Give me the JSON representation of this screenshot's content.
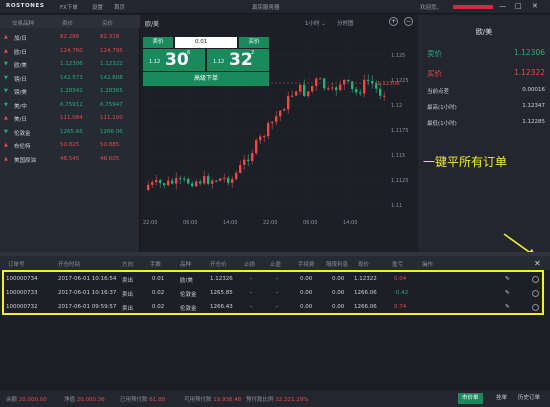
{
  "topbar": {
    "logo": "ROSTONES",
    "menu": [
      "FX下单",
      "设置",
      "首页"
    ],
    "server": "真实服务器",
    "welcome": "欢迎您，",
    "win_minimize": "—",
    "win_maximize": "□",
    "win_close": "✕"
  },
  "quotes": {
    "headers": [
      "交易品种",
      "卖价",
      "买价"
    ],
    "rows": [
      {
        "name": "加/日",
        "bid": "82.286",
        "ask": "82.318",
        "dir": "up"
      },
      {
        "name": "欧/日",
        "bid": "124.760",
        "ask": "124.795",
        "dir": "up"
      },
      {
        "name": "欧/美",
        "bid": "1.12306",
        "ask": "1.12322",
        "dir": "down"
      },
      {
        "name": "镑/日",
        "bid": "142.573",
        "ask": "142.608",
        "dir": "down"
      },
      {
        "name": "镑/美",
        "bid": "1.28342",
        "ask": "1.28365",
        "dir": "down"
      },
      {
        "name": "美/中",
        "bid": "6.75912",
        "ask": "6.75947",
        "dir": "down"
      },
      {
        "name": "美/日",
        "bid": "111.084",
        "ask": "111.100",
        "dir": "up"
      },
      {
        "name": "伦敦金",
        "bid": "1265.66",
        "ask": "1266.06",
        "dir": "down"
      },
      {
        "name": "布伦特",
        "bid": "50.825",
        "ask": "50.885",
        "dir": "up"
      },
      {
        "name": "美国原油",
        "bid": "48.545",
        "ask": "48.605",
        "dir": "up"
      }
    ]
  },
  "chart": {
    "symbol": "欧/美",
    "timeframe": "1小时",
    "chart_type": "分时图",
    "zoom_in": "+",
    "zoom_out": "−",
    "price_label": "1.12306",
    "yticks": [
      "1.125",
      "1.1225",
      "1.12",
      "1.1175",
      "1.115",
      "1.1125",
      "1.11"
    ],
    "xticks": [
      "22:00",
      "06:00",
      "14:00",
      "22:00",
      "06:00",
      "14:00"
    ],
    "colors": {
      "up": "#e84a4a",
      "down": "#26b07a"
    }
  },
  "trade_panel": {
    "sell_label": "卖价",
    "lot_value": "0.01",
    "buy_label": "买价",
    "sell_quote": {
      "small": "1.12",
      "large": "30",
      "tiny": "6"
    },
    "buy_quote": {
      "small": "1.12",
      "large": "32",
      "tiny": "2"
    },
    "advanced_order": "高级下单"
  },
  "info_panel": {
    "title": "欧/美",
    "rows": [
      {
        "label": "卖价",
        "value": "1.12306",
        "color": "#26b07a"
      },
      {
        "label": "买价",
        "value": "1.12322",
        "color": "#e84a4a"
      },
      {
        "label": "当前点差",
        "value": "0.00016",
        "color": "#d2d5db"
      },
      {
        "label": "最高(1小时)",
        "value": "1.12347",
        "color": "#d2d5db"
      },
      {
        "label": "最低(1小时)",
        "value": "1.12285",
        "color": "#d2d5db"
      }
    ]
  },
  "annotation": "一键平所有订单",
  "positions": {
    "headers": [
      "订单号",
      "开仓时间",
      "方向",
      "手数",
      "品种",
      "开仓价",
      "止损",
      "止盈",
      "手续费",
      "隔夜利息",
      "现价",
      "盈亏",
      "操作"
    ],
    "rows": [
      {
        "id": "100000734",
        "time": "2017-06-01 10:16:54",
        "dir": "卖出",
        "lots": "0.01",
        "sym": "欧/美",
        "open": "1.12326",
        "sl": "-",
        "tp": "-",
        "fee": "0.00",
        "swap": "0.00",
        "cur": "1.12322",
        "pl": "0.04",
        "plc": "#e84a4a"
      },
      {
        "id": "100000733",
        "time": "2017-06-01 10:16:37",
        "dir": "卖出",
        "lots": "0.02",
        "sym": "伦敦金",
        "open": "1265.85",
        "sl": "-",
        "tp": "-",
        "fee": "0.00",
        "swap": "0.00",
        "cur": "1266.06",
        "pl": "-0.42",
        "plc": "#26b07a"
      },
      {
        "id": "100000732",
        "time": "2017-06-01 09:59:57",
        "dir": "卖出",
        "lots": "0.02",
        "sym": "伦敦金",
        "open": "1266.43",
        "sl": "-",
        "tp": "-",
        "fee": "0.00",
        "swap": "0.00",
        "cur": "1266.06",
        "pl": "0.74",
        "plc": "#e84a4a"
      }
    ],
    "close_all": "✕"
  },
  "status": {
    "items": [
      {
        "label": "余额",
        "value": "20,000.00"
      },
      {
        "label": "净值",
        "value": "20,000.36"
      },
      {
        "label": "已用预付款",
        "value": "61.88"
      },
      {
        "label": "可用预付款",
        "value": "19,938.48"
      },
      {
        "label": "预付款比例",
        "value": "32,321.29%"
      }
    ],
    "tabs": [
      "市价单",
      "挂单",
      "历史订单"
    ]
  }
}
